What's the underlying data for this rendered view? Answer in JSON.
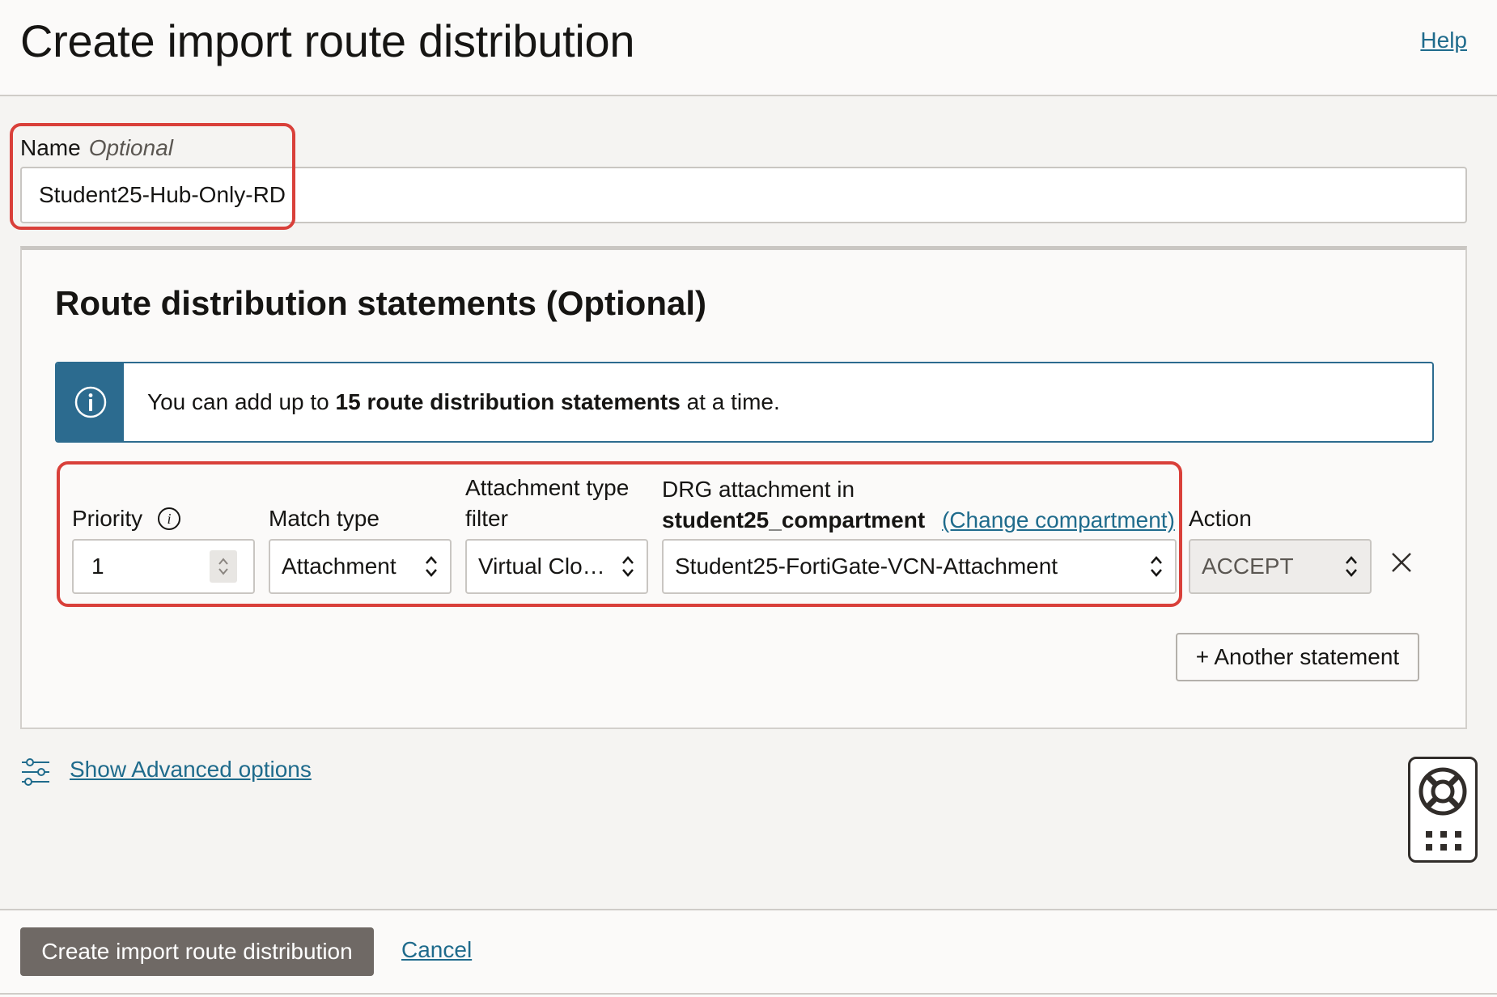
{
  "header": {
    "title": "Create import route distribution",
    "help_label": "Help"
  },
  "name_field": {
    "label": "Name",
    "optional_label": "Optional",
    "value": "Student25-Hub-Only-RD"
  },
  "statements": {
    "title": "Route distribution statements (Optional)",
    "info": {
      "prefix": "You can add up to ",
      "bold": "15 route distribution statements",
      "suffix": " at a time."
    },
    "columns": {
      "priority": "Priority",
      "match_type": "Match type",
      "attachment_type_line1": "Attachment type",
      "attachment_type_line2": "filter",
      "drg_line1": "DRG attachment in",
      "drg_compartment": "student25_compartment",
      "change_compartment": "(Change compartment)",
      "action": "Action"
    },
    "row": {
      "priority": "1",
      "match_type": "Attachment",
      "attachment_type": "Virtual Clo…",
      "drg_attachment": "Student25-FortiGate-VCN-Attachment",
      "action": "ACCEPT"
    },
    "add_statement_label": "+ Another statement"
  },
  "advanced": {
    "label": "Show Advanced options"
  },
  "footer": {
    "create_label": "Create import route distribution",
    "cancel_label": "Cancel"
  },
  "colors": {
    "accent_link": "#1f6b8c",
    "info_blue": "#2c6b8f",
    "highlight_red": "#d9403a",
    "primary_button": "#6f6965"
  }
}
